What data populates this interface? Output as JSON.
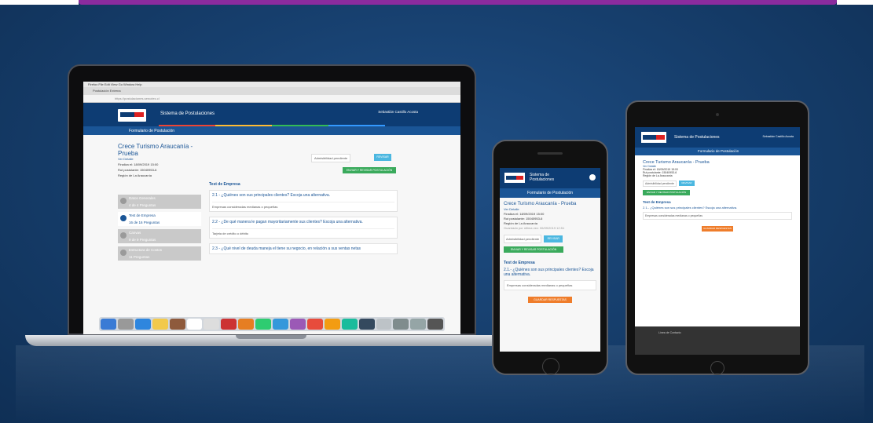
{
  "laptop": {
    "menubar": "Firefox   File   Edit   View   Go   Window   Help",
    "tab": "Postulación Externa",
    "url": "https://postulaciones.sercotec.cl",
    "app_title": "Sistema de Postulaciones",
    "user": "Sebastián Castillo Acosta",
    "subbar": "Formulario de Postulación",
    "project": {
      "title": "Crece Turismo Araucanía - Prueba",
      "subtitle": "Ver Detalle",
      "line1": "Finaliza el: 18/09/2019 15:00",
      "line2": "Rut postulante: 15040953-6",
      "line3": "Región de La Araucanía"
    },
    "warning": "Admisibilidad pendiente",
    "warning_btn": "REVISAR",
    "send_btn": "ENVIAR Y REVISAR POSTULACIÓN",
    "sidebar": [
      {
        "label": "Datos Generales",
        "sub": "4 de 4 Preguntas",
        "active": false
      },
      {
        "label": "Test de Empresa",
        "sub": "16 de 16 Preguntas",
        "active": true
      },
      {
        "label": "Canvas",
        "sub": "9 de 9 Preguntas",
        "active": false
      },
      {
        "label": "Estructura de Costos",
        "sub": "11 Preguntas",
        "active": false
      }
    ],
    "test_heading": "Test de Empresa",
    "questions": [
      {
        "q": "2.1 - ¿Quiénes son sus principales clientes? Escoja una alternativa.",
        "a": "Empresas consideradas medianas o pequeñas"
      },
      {
        "q": "2.2 - ¿De qué manera le pagan mayoritariamente sus clientes? Escoja una alternativa.",
        "a": "Tarjeta de crédito o débito"
      },
      {
        "q": "2.3 - ¿Qué nivel de deuda maneja el tiene su negocio, en relación a sus ventas netas",
        "a": ""
      }
    ]
  },
  "phone": {
    "app_title": "Sistema de Postulaciones",
    "subbar": "Formulario de Postulación",
    "project": "Crece Turismo Araucanía - Prueba",
    "detail": "Ver Detalle",
    "line1": "Finaliza el: 18/09/2019 15:00",
    "line2": "Rut postulante: 15040953-6",
    "line3": "Región de La Araucanía",
    "line4": "Guardado por última vez: 06/09/2019 12:51",
    "warning": "Admisibilidad pendiente",
    "warning_btn": "REVISAR",
    "send_btn": "ENVIAR Y REVISAR POSTULACIÓN",
    "test_heading": "Test de Empresa",
    "question": "2.1.- ¿Quiénes son sus principales clientes? Escoja una alternativa.",
    "answer": "Empresas consideradas medianas o pequeñas",
    "next_btn": "GUARDAR RESPUESTAS"
  },
  "tablet": {
    "app_title": "Sistema de Postulaciones",
    "user": "Sebastián Castillo Acosta",
    "subbar": "Formulario de Postulación",
    "project": "Crece Turismo Araucanía - Prueba",
    "detail": "Ver Detalle",
    "line1": "Finaliza el: 18/09/2019 15:00",
    "line2": "Rut postulante: 15040953-6",
    "line3": "Región de La Araucanía",
    "warning": "Admisibilidad pendiente",
    "warning_btn": "REVISAR",
    "send_btn": "ENVIAR Y REVISAR POSTULACIÓN",
    "test_heading": "Test de Empresa",
    "question": "2.1.- ¿Quiénes son sus principales clientes? Escoja una alternativa.",
    "answer": "Empresas consideradas medianas o pequeñas",
    "next_btn": "GUARDAR RESPUESTAS",
    "footer": "Línea de Contacto"
  },
  "colors": {
    "brand_dark": "#0d3c73",
    "brand": "#1a5596",
    "accent_purple": "#8b2b9e",
    "success": "#3aaa5c",
    "info": "#4bb7e0",
    "warning": "#ef7d2b"
  },
  "dock_colors": [
    "#3a7bd5",
    "#999",
    "#2e86de",
    "#f2c94c",
    "#8e5a3c",
    "#fff",
    "#ddd",
    "#c33",
    "#e67e22",
    "#2ecc71",
    "#3498db",
    "#9b59b6",
    "#e74c3c",
    "#f39c12",
    "#1abc9c",
    "#34495e",
    "#bdc3c7",
    "#7f8c8d",
    "#95a5a6",
    "#555"
  ]
}
